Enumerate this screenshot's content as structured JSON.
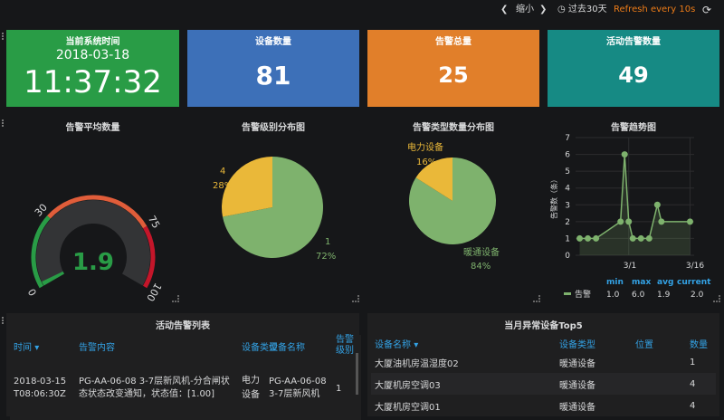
{
  "topbar": {
    "prev_icon": "chevron-left-icon",
    "zoom_out_label": "缩小",
    "next_icon": "chevron-right-icon",
    "time_range_label": "过去30天",
    "refresh_label": "Refresh every 10s",
    "refresh_icon": "refresh-icon"
  },
  "stats": {
    "time": {
      "title": "当前系统时间",
      "date": "2018-03-18",
      "clock": "11:37:32",
      "color": "#299c46"
    },
    "devices": {
      "title": "设备数量",
      "value": "81",
      "color": "#3d70b8"
    },
    "alarms_total": {
      "title": "告警总量",
      "value": "25",
      "color": "#e17f2a"
    },
    "active_alarms": {
      "title": "活动告警数量",
      "value": "49",
      "color": "#168a84"
    }
  },
  "gauge": {
    "title": "告警平均数量",
    "value": "1.9",
    "value_num": 1.9,
    "min": 0,
    "max": 100,
    "thresholds": [
      30,
      75
    ],
    "tick_labels": [
      "0",
      "30",
      "75",
      "100"
    ],
    "colors": {
      "ok": "#299c46",
      "warn": "#e05d3a",
      "crit": "#c4162a",
      "text": "#299c46"
    }
  },
  "pies": [
    {
      "title": "告警级别分布图",
      "slices": [
        {
          "label": "1",
          "pct": 72,
          "pct_label": "72%",
          "color": "#7eb26d"
        },
        {
          "label": "4",
          "pct": 28,
          "pct_label": "28%",
          "color": "#eab839"
        }
      ]
    },
    {
      "title": "告警类型数量分布图",
      "slices": [
        {
          "label": "暖通设备",
          "pct": 84,
          "pct_label": "84%",
          "color": "#7eb26d"
        },
        {
          "label": "电力设备",
          "pct": 16,
          "pct_label": "16%",
          "color": "#eab839"
        }
      ]
    }
  ],
  "chart_data": {
    "type": "line",
    "title": "告警趋势图",
    "ylabel": "告警数（条）",
    "ylim": [
      0,
      7
    ],
    "y_ticks": [
      "0",
      "1",
      "2",
      "3",
      "4",
      "5",
      "6",
      "7"
    ],
    "x_tick_labels": [
      "3/1",
      "3/16"
    ],
    "series": [
      {
        "name": "告警",
        "color": "#7eb26d",
        "x": [
          "2018-02-17",
          "2018-02-19",
          "2018-02-21",
          "2018-02-27",
          "2018-02-28",
          "2018-03-01",
          "2018-03-02",
          "2018-03-04",
          "2018-03-06",
          "2018-03-08",
          "2018-03-09",
          "2018-03-16"
        ],
        "values": [
          1,
          1,
          1,
          2,
          6,
          2,
          1,
          1,
          1,
          3,
          2,
          2
        ]
      }
    ],
    "legend": {
      "headers": [
        "min",
        "max",
        "avg",
        "current"
      ],
      "rows": [
        {
          "name": "告警",
          "values": [
            "1.0",
            "6.0",
            "1.9",
            "2.0"
          ]
        }
      ]
    }
  },
  "active_table": {
    "title": "活动告警列表",
    "columns": [
      "时间",
      "告警内容",
      "设备类型",
      "设备名称",
      "告警级别"
    ],
    "sort_icon": "caret-down-icon",
    "rows": [
      [
        "2018-03-15T08:06:30Z",
        "PG-AA-06-08 3-7层新风机-分合闸状态状态改变通知，状态值：[1.00]",
        "电力设备",
        "PG-AA-06-08 3-7层新风机",
        "1"
      ]
    ]
  },
  "top5_table": {
    "title": "当月异常设备Top5",
    "columns": [
      "设备名称",
      "设备类型",
      "位置",
      "数量"
    ],
    "sort_icon": "caret-down-icon",
    "rows": [
      [
        "大厦油机房温湿度02",
        "暖通设备",
        "",
        "1"
      ],
      [
        "大厦机房空调03",
        "暖通设备",
        "",
        "4"
      ],
      [
        "大厦机房空调01",
        "暖通设备",
        "",
        "4"
      ]
    ]
  }
}
